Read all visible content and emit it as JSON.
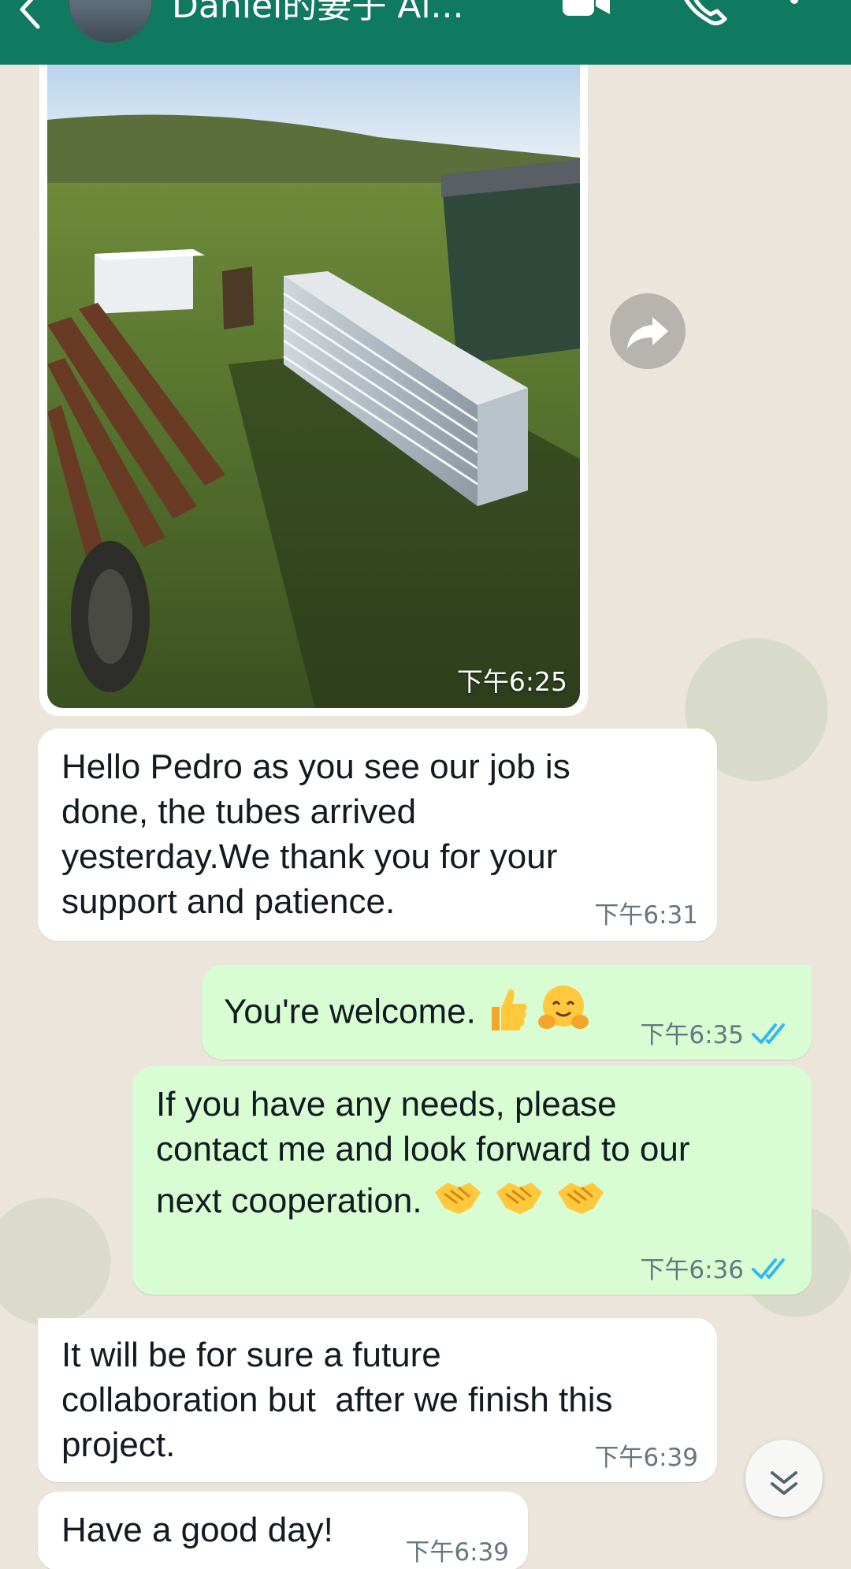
{
  "header": {
    "title": "Daniel的妻子 Al...",
    "back_icon": "back-arrow-icon",
    "video_icon": "video-call-icon",
    "call_icon": "phone-icon",
    "menu_icon": "more-vert-icon",
    "bg_color": "#0f7a5f"
  },
  "messages": [
    {
      "type": "image",
      "direction": "incoming",
      "time": "下午6:25"
    },
    {
      "direction": "incoming",
      "lines": [
        "Hello Pedro as you see our job is",
        "done, the tubes arrived",
        "yesterday.We thank you for your",
        "support and patience."
      ],
      "time": "下午6:31"
    },
    {
      "direction": "outgoing",
      "lines": [
        "You're welcome."
      ],
      "emojis": [
        "thumbs-up-emoji",
        "hugging-face-emoji"
      ],
      "time": "下午6:35",
      "status": "read"
    },
    {
      "direction": "outgoing",
      "lines": [
        "If you have any needs, please",
        "contact me and look forward to our",
        "next cooperation."
      ],
      "emojis": [
        "handshake-emoji",
        "handshake-emoji",
        "handshake-emoji"
      ],
      "time": "下午6:36",
      "status": "read"
    },
    {
      "direction": "incoming",
      "lines": [
        "It will be for sure a future",
        "collaboration but  after we finish this",
        "project."
      ],
      "time": "下午6:39"
    },
    {
      "direction": "incoming",
      "lines": [
        "Have a good day!"
      ],
      "time": "下午6:39"
    }
  ],
  "colors": {
    "incoming_bubble": "#ffffff",
    "outgoing_bubble": "#d9fdd3",
    "read_ticks": "#34b7f1"
  },
  "controls": {
    "forward_icon": "forward-icon",
    "scroll_down_icon": "double-chevron-down-icon"
  }
}
